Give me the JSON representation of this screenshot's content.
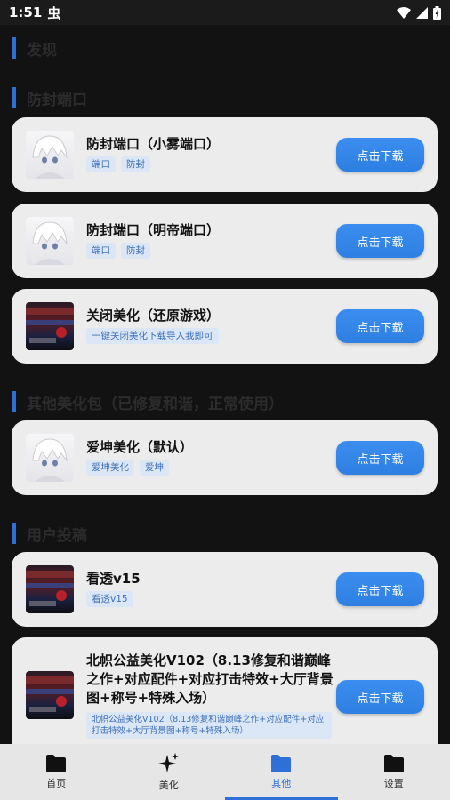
{
  "status": {
    "time": "1:51",
    "bug_glyph": "虫"
  },
  "sections": {
    "discover": "发现",
    "anti_ban": "防封端口",
    "other": "其他美化包（已修复和谐，正常使用）",
    "user": "用户投稿"
  },
  "cards": [
    {
      "title": "防封端口（小雾端口）",
      "tags": [
        "端口",
        "防封"
      ],
      "button": "点击下载",
      "thumb": "anime"
    },
    {
      "title": "防封端口（明帝端口）",
      "tags": [
        "端口",
        "防封"
      ],
      "button": "点击下载",
      "thumb": "anime"
    },
    {
      "title": "关闭美化（还原游戏）",
      "tags": [
        "一键关闭美化下载导入我即可"
      ],
      "button": "点击下载",
      "thumb": "game"
    },
    {
      "title": "爱坤美化（默认）",
      "tags": [
        "爱坤美化",
        "爱坤"
      ],
      "button": "点击下载",
      "thumb": "anime"
    },
    {
      "title": "看透v15",
      "tags": [
        "看透v15"
      ],
      "button": "点击下载",
      "thumb": "game"
    },
    {
      "title": "北帜公益美化V102（8.13修复和谐巅峰之作+对应配件+对应打击特效+大厅背景图+称号+特殊入场）",
      "tags": [
        "北帜公益美化V102（8.13修复和谐巅峰之作+对应配件+对应打击特效+大厅背景图+称号+特殊入场）"
      ],
      "button": "点击下载",
      "thumb": "game"
    }
  ],
  "tabs": [
    {
      "label": "首页",
      "icon": "folder-icon"
    },
    {
      "label": "美化",
      "icon": "sparkle-icon"
    },
    {
      "label": "其他",
      "icon": "folder-icon"
    },
    {
      "label": "设置",
      "icon": "folder-icon"
    }
  ],
  "colors": {
    "accent": "#2f6fd8",
    "button": "#3189ea",
    "card": "#ececec"
  }
}
